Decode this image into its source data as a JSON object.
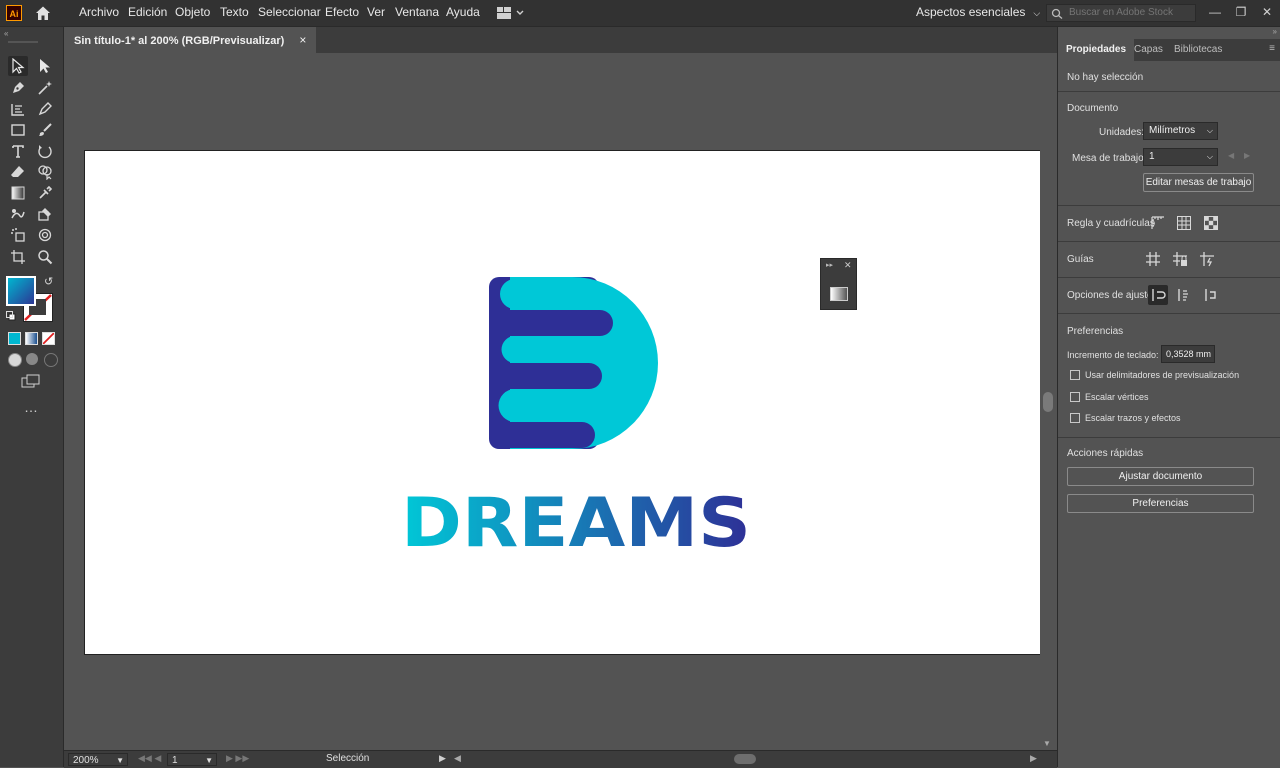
{
  "app": {
    "logo_text": "Ai"
  },
  "menu": [
    "Archivo",
    "Edición",
    "Objeto",
    "Texto",
    "Seleccionar",
    "Efecto",
    "Ver",
    "Ventana",
    "Ayuda"
  ],
  "workspace": {
    "label": "Aspectos esenciales"
  },
  "search": {
    "placeholder": "Buscar en Adobe Stock"
  },
  "document_tab": {
    "title": "Sin título-1* al 200% (RGB/Previsualizar)",
    "close": "×"
  },
  "artwork": {
    "logo_text": "DREAMS",
    "colors": {
      "cyan": "#00c8d7",
      "navy": "#2e2f96"
    }
  },
  "statusbar": {
    "zoom": "200%",
    "artboard": "1",
    "tool": "Selección"
  },
  "panel": {
    "tabs": [
      "Propiedades",
      "Capas",
      "Bibliotecas"
    ],
    "selection_status": "No hay selección",
    "document": {
      "title": "Documento",
      "units_label": "Unidades:",
      "units_value": "Milímetros",
      "artboard_label": "Mesa de trabajo:",
      "artboard_value": "1",
      "edit_artboards": "Editar mesas de trabajo"
    },
    "rulers_label": "Regla y cuadrículas",
    "guides_label": "Guías",
    "snap_label": "Opciones de ajuste",
    "preferences": {
      "title": "Preferencias",
      "keyboard_increment_label": "Incremento de teclado:",
      "keyboard_increment_value": "0,3528 mm",
      "checkboxes": [
        "Usar delimitadores de previsualización",
        "Escalar vértices",
        "Escalar trazos y efectos"
      ]
    },
    "quick_actions": {
      "title": "Acciones rápidas",
      "fit_document": "Ajustar documento",
      "preferences_btn": "Preferencias"
    }
  }
}
